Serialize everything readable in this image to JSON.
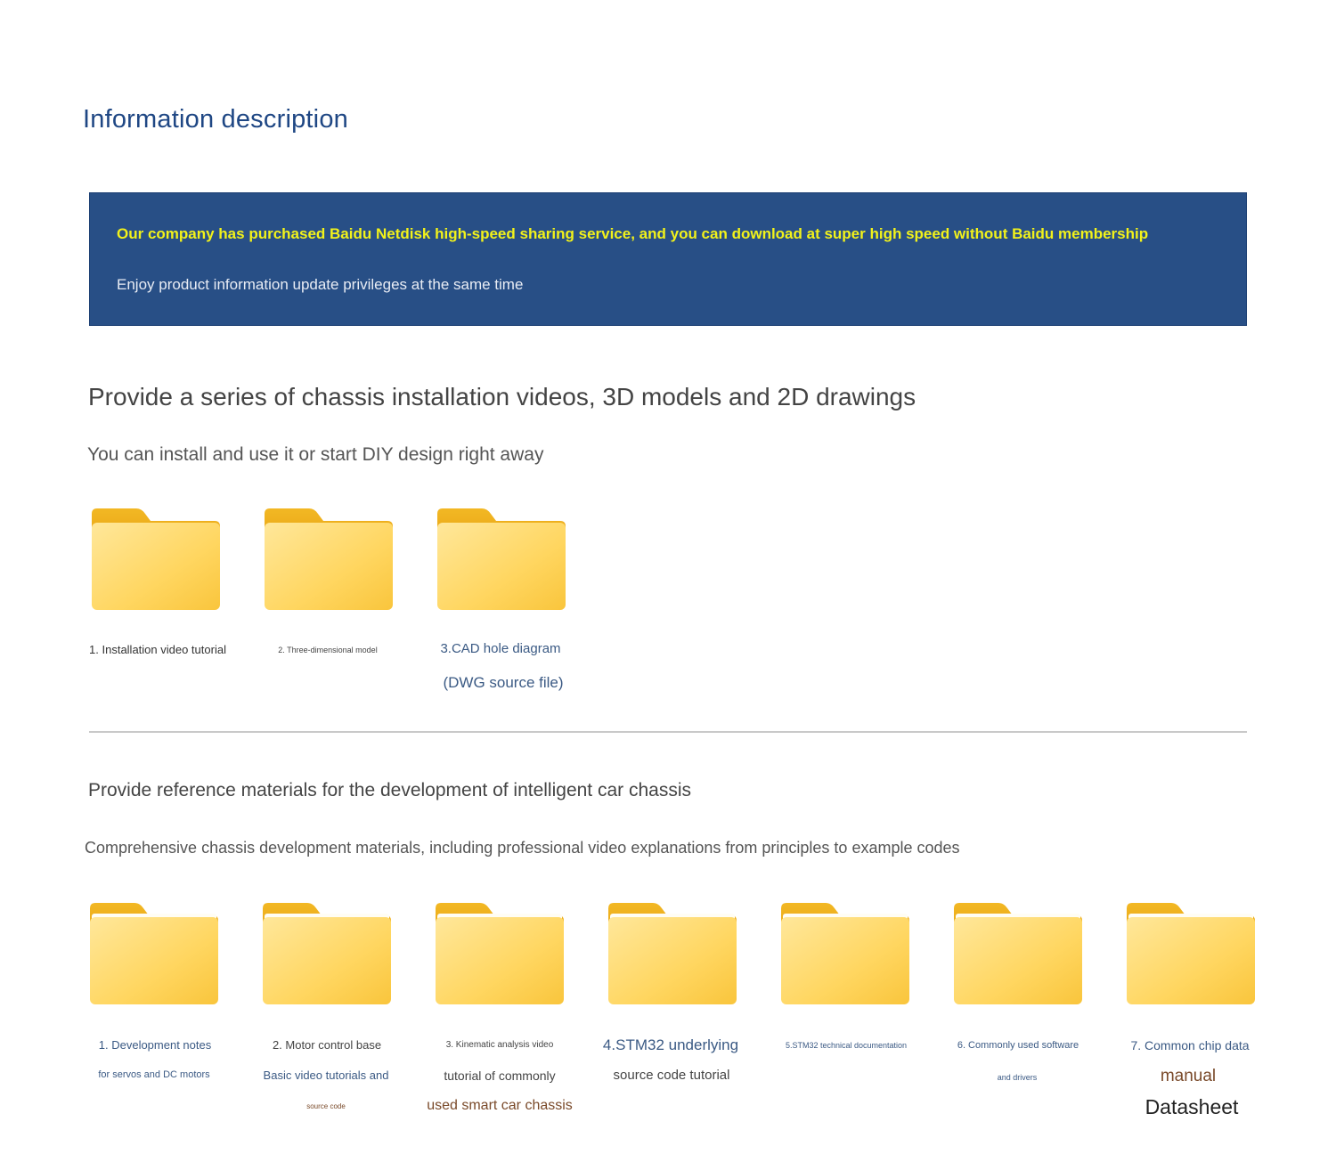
{
  "page_title": "Information description",
  "banner": {
    "line1": "Our company has purchased Baidu Netdisk high-speed sharing service, and you can download at super high speed without Baidu membership",
    "line2": "Enjoy product information update privileges at the same time",
    "bg_color": "#284f86",
    "highlight_color": "#f2f21a"
  },
  "section1": {
    "title": "Provide a series of chassis installation videos, 3D models and 2D drawings",
    "subtitle": "You can install and use it or start DIY design right away",
    "folders": [
      {
        "lines": [
          "1. Installation video tutorial"
        ]
      },
      {
        "lines": [
          "2. Three-dimensional model"
        ]
      },
      {
        "lines": [
          "3.CAD hole diagram",
          "(DWG source file)"
        ]
      }
    ]
  },
  "section2": {
    "title": "Provide reference materials for the development of intelligent car chassis",
    "subtitle": "Comprehensive chassis development materials, including professional video explanations from principles to example codes",
    "folders": [
      {
        "lines": [
          "1. Development notes",
          "for servos and DC motors"
        ]
      },
      {
        "lines": [
          "2. Motor control base",
          "Basic video tutorials and",
          "source code"
        ]
      },
      {
        "lines": [
          "3. Kinematic analysis video",
          "tutorial of commonly",
          "used smart car chassis"
        ]
      },
      {
        "lines": [
          "4.STM32 underlying",
          "source code tutorial"
        ]
      },
      {
        "lines": [
          "5.STM32 technical documentation"
        ]
      },
      {
        "lines": [
          "6. Commonly used software",
          "and drivers"
        ]
      },
      {
        "lines": [
          "7. Common chip data",
          "manual",
          "Datasheet"
        ]
      }
    ]
  },
  "icons": {
    "folder": "folder-icon"
  }
}
